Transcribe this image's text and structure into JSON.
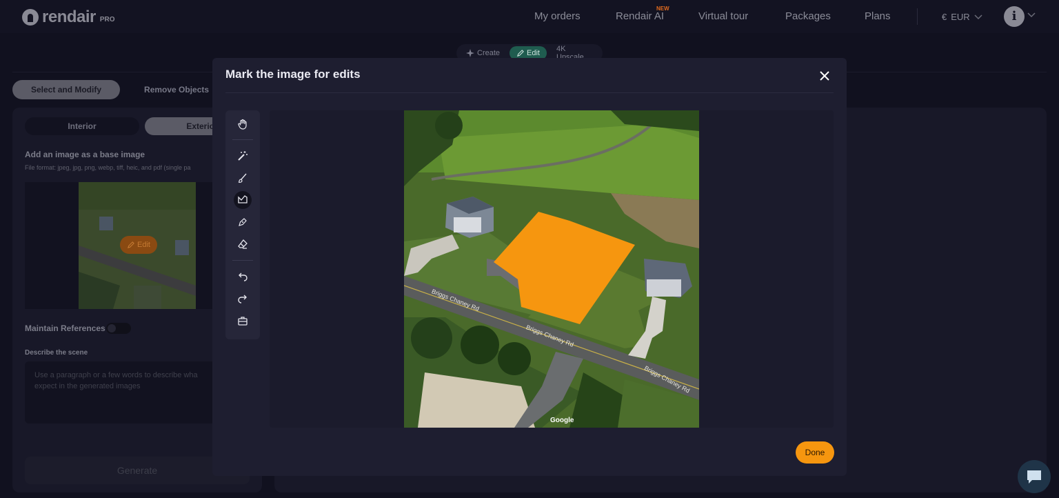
{
  "brand": {
    "name": "rendair",
    "tier": "PRO"
  },
  "nav": {
    "items": [
      {
        "label": "My orders"
      },
      {
        "label": "Rendair AI",
        "badge": "NEW"
      },
      {
        "label": "Virtual tour"
      },
      {
        "label": "Packages"
      },
      {
        "label": "Plans"
      }
    ],
    "currency": {
      "symbol": "€",
      "code": "EUR"
    },
    "avatar_initial": "i"
  },
  "mode_tabs": [
    {
      "label": "Create",
      "active": false
    },
    {
      "label": "Edit",
      "active": true
    },
    {
      "label": "4K Upscale",
      "active": false
    }
  ],
  "edit_tabs": [
    {
      "label": "Select and Modify",
      "active": true
    },
    {
      "label": "Remove Objects",
      "active": false
    }
  ],
  "left_panel": {
    "segments": [
      {
        "label": "Interior",
        "active": false
      },
      {
        "label": "Exterior",
        "active": true
      }
    ],
    "base_image_title": "Add an image as a base image",
    "file_format_note": "File format: jpeg, jpg, png, webp, tiff, heic, and pdf (single pa",
    "edit_label": "Edit",
    "maintain_references_label": "Maintain References",
    "maintain_references_on": false,
    "describe_label": "Describe the scene",
    "describe_placeholder": "Use a paragraph or a few words to describe wha expect in the generated images",
    "generate_label": "Generate"
  },
  "modal": {
    "title": "Mark the image for edits",
    "tools": [
      "hand-icon",
      "magic-wand-icon",
      "brush-icon",
      "lasso-icon",
      "pen-icon",
      "eraser-icon",
      "undo-icon",
      "redo-icon",
      "clear-icon"
    ],
    "active_tool": "lasso-icon",
    "image": {
      "road_labels": [
        "Briggs Chaney Rd",
        "Briggs Chaney Rd",
        "Briggs Chaney Rd"
      ],
      "attribution": "Google",
      "mask_color": "#f6960f"
    },
    "done_label": "Done"
  },
  "colors": {
    "accent": "#f6960f",
    "edit_active": "#1f5c4f",
    "background": "#11111f"
  }
}
